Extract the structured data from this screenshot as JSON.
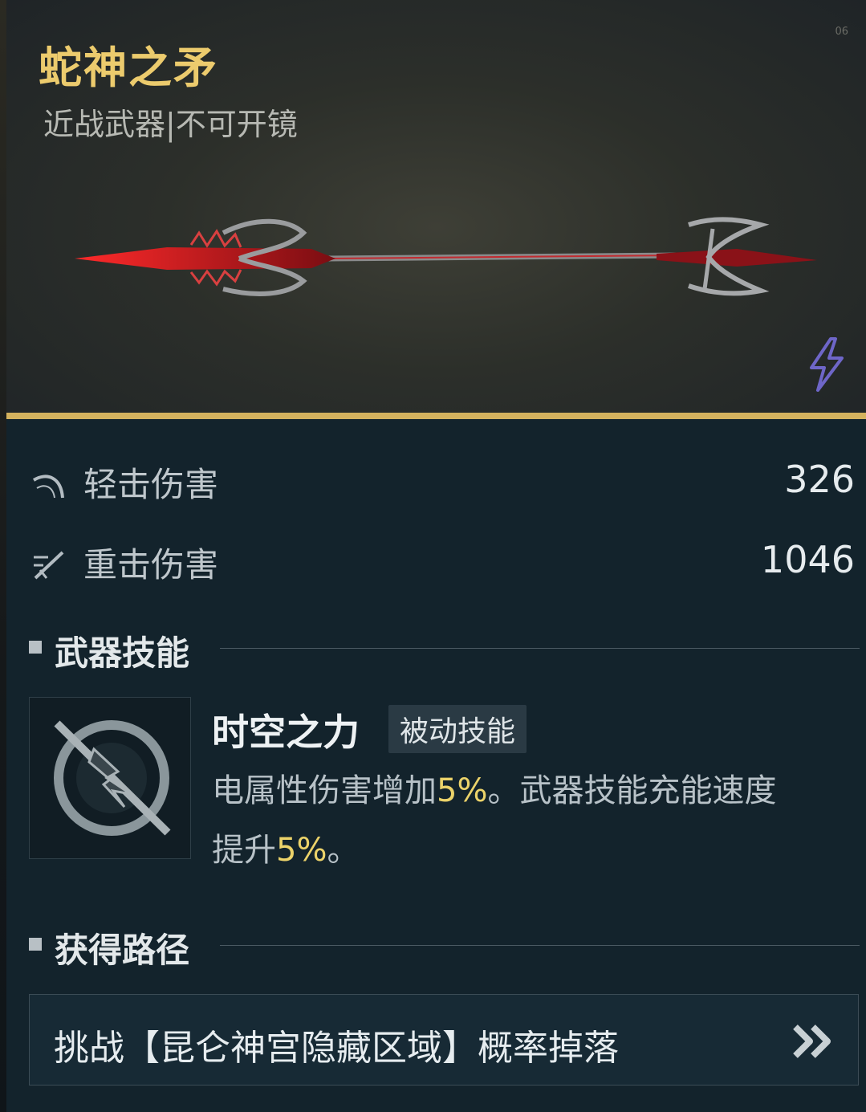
{
  "item": {
    "title": "蛇神之矛",
    "subtitle": "近战武器|不可开镜",
    "corner_mark": "06"
  },
  "stats": [
    {
      "label": "轻击伤害",
      "value": "326",
      "icon": "light-attack-icon"
    },
    {
      "label": "重击伤害",
      "value": "1046",
      "icon": "heavy-attack-icon"
    }
  ],
  "skill_section": {
    "heading": "武器技能",
    "name": "时空之力",
    "tag": "被动技能",
    "desc_part1": "电属性伤害增加",
    "desc_hl1": "5%",
    "desc_part2": "。武器技能充能速度提升",
    "desc_hl2": "5%",
    "desc_part3": "。"
  },
  "source_section": {
    "heading": "获得路径",
    "text": "挑战【昆仑神宫隐藏区域】概率掉落"
  },
  "colors": {
    "title_gold": "#eccb6d",
    "accent_line": "#d4b25e",
    "highlight": "#ecd36a",
    "element_icon": "#6e66c8"
  }
}
